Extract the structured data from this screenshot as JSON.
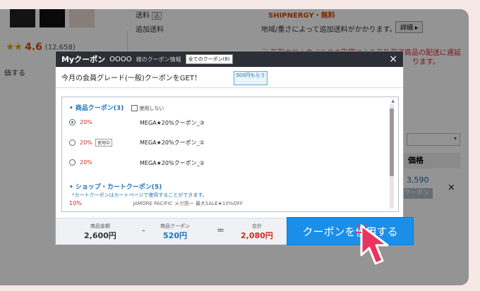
{
  "bg": {
    "shipping_label": "送料",
    "shipping_tag": "込",
    "shipping_status": "SHIPNERGY・無料",
    "extra_shipping_label": "追加送料",
    "extra_shipping_note": "地域/重さによって追加送料がかかります。",
    "detail_button": "詳細 ▸",
    "covid_line1": "新型コロナウイルスの影響により海外発送商品の配送に遅延",
    "covid_line2": "ります。",
    "stars": "★★",
    "rating_value": "4.6",
    "rating_count": "(12,658)",
    "review_link": "価する",
    "side_header": "価格",
    "side_price": "3,590",
    "side_close": "×",
    "side_button": "クーポン"
  },
  "modal": {
    "title": "Myクーポン",
    "user": "OOOO",
    "subtitle": "様のクーポン情報",
    "all_coupons": "全てのクーポン(8)",
    "close": "×",
    "grade_text": "今月の会員グレード(一般)クーポンをGET！",
    "badge_500": "500円もらう",
    "product_section": "商品クーポン(3)",
    "no_use_label": "使用しない",
    "coupons": [
      {
        "pct": "20%",
        "name": "MEGA★20%クーポン_③",
        "selected": true,
        "in_use": ""
      },
      {
        "pct": "20%",
        "name": "MEGA★20%クーポン_①",
        "selected": false,
        "in_use": "使用中"
      },
      {
        "pct": "20%",
        "name": "MEGA★20%クーポン_②",
        "selected": false,
        "in_use": ""
      }
    ],
    "shop_section": "ショップ・カートクーポン(5)",
    "shop_note": "*カートクーポンはカートページで使用することができます。",
    "cut_pct": "10%",
    "cut_name": "JAMORE PACIFIC メガ割ー 最大SALE★10%OFF"
  },
  "totals": {
    "product_total_label": "商品金額",
    "product_total": "2,600円",
    "minus": "-",
    "coupon_label": "商品クーポン",
    "coupon_value": "520円",
    "equals": "=",
    "sum_label": "合計",
    "sum_value": "2,080円"
  },
  "apply_button": "クーポンを使用する",
  "colors": {
    "accent_blue": "#1b8fe8",
    "discount_red": "#d92525",
    "header_dark": "#2c3036",
    "backdrop": "#f6e8e6",
    "cursor_pink": "#e8355f"
  }
}
